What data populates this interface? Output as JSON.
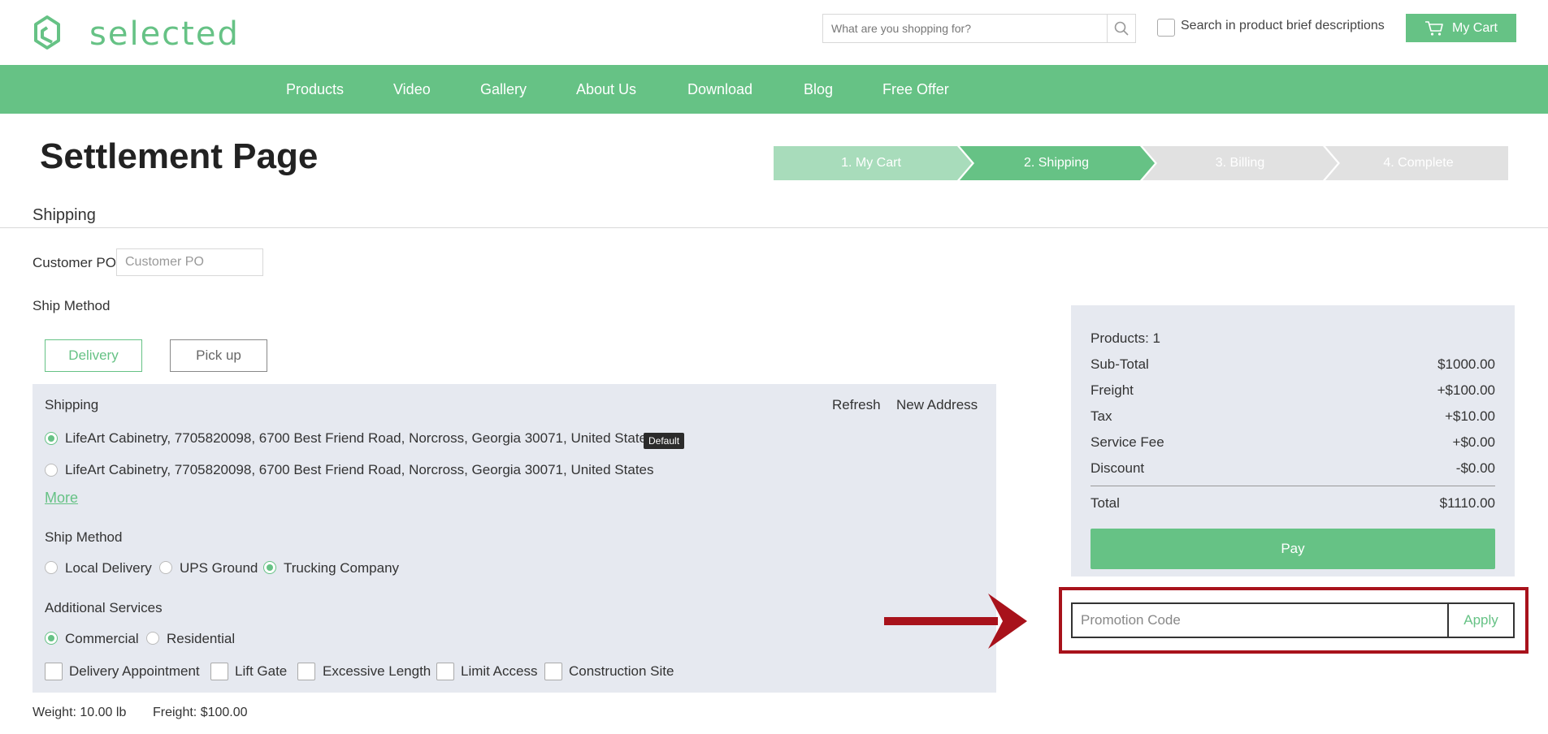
{
  "header": {
    "logo_text": "selected",
    "search": {
      "placeholder": "What are you shopping for?",
      "value": ""
    },
    "brief_search_label": "Search in product brief descriptions",
    "cart_label": "My Cart"
  },
  "nav": {
    "items": [
      {
        "label": "Products"
      },
      {
        "label": "Video"
      },
      {
        "label": "Gallery"
      },
      {
        "label": "About Us"
      },
      {
        "label": "Download"
      },
      {
        "label": "Blog"
      },
      {
        "label": "Free Offer"
      }
    ]
  },
  "page": {
    "title": "Settlement Page",
    "section_title": "Shipping"
  },
  "steps": [
    {
      "label": "1. My Cart",
      "state": "done"
    },
    {
      "label": "2. Shipping",
      "state": "active"
    },
    {
      "label": "3. Billing",
      "state": "todo"
    },
    {
      "label": "4. Complete",
      "state": "todo"
    }
  ],
  "form": {
    "customer_po_label": "Customer PO",
    "customer_po_placeholder": "Customer PO",
    "ship_method_label": "Ship Method",
    "delivery_label": "Delivery",
    "pickup_label": "Pick up"
  },
  "shipping_panel": {
    "title": "Shipping",
    "refresh_label": "Refresh",
    "new_address_label": "New Address",
    "addresses": [
      {
        "text": "LifeArt Cabinetry, 7705820098, 6700 Best Friend Road, Norcross, Georgia 30071, United States",
        "selected": true,
        "badge": "Default"
      },
      {
        "text": "LifeArt Cabinetry, 7705820098, 6700 Best Friend Road, Norcross, Georgia 30071, United States",
        "selected": false
      }
    ],
    "more_label": "More",
    "ship_method_title": "Ship Method",
    "ship_methods": [
      {
        "label": "Local Delivery",
        "selected": false
      },
      {
        "label": "UPS Ground",
        "selected": false
      },
      {
        "label": "Trucking Company",
        "selected": true
      }
    ],
    "additional_services_title": "Additional Services",
    "service_types": [
      {
        "label": "Commercial",
        "selected": true
      },
      {
        "label": "Residential",
        "selected": false
      }
    ],
    "services": [
      {
        "label": "Delivery Appointment",
        "checked": false
      },
      {
        "label": "Lift Gate",
        "checked": false
      },
      {
        "label": "Excessive Length",
        "checked": false
      },
      {
        "label": "Limit Access",
        "checked": false
      },
      {
        "label": "Construction Site",
        "checked": false
      }
    ]
  },
  "totals_line": {
    "weight": "Weight: 10.00 lb",
    "freight": "Freight: $100.00"
  },
  "summary": {
    "products": "Products: 1",
    "rows": [
      {
        "label": "Sub-Total",
        "value": "$1000.00"
      },
      {
        "label": "Freight",
        "value": "+$100.00"
      },
      {
        "label": "Tax",
        "value": "+$10.00"
      },
      {
        "label": "Service Fee",
        "value": "+$0.00"
      },
      {
        "label": "Discount",
        "value": "-$0.00"
      }
    ],
    "total_label": "Total",
    "total_value": "$1110.00",
    "pay_label": "Pay"
  },
  "promo": {
    "placeholder": "Promotion Code",
    "value": "",
    "apply_label": "Apply"
  },
  "colors": {
    "brand_green": "#66c285",
    "step_done": "#a8dcbb",
    "step_todo": "#e1e1e1",
    "panel_bg": "#e6e9f0",
    "highlight_red": "#a8121b"
  }
}
